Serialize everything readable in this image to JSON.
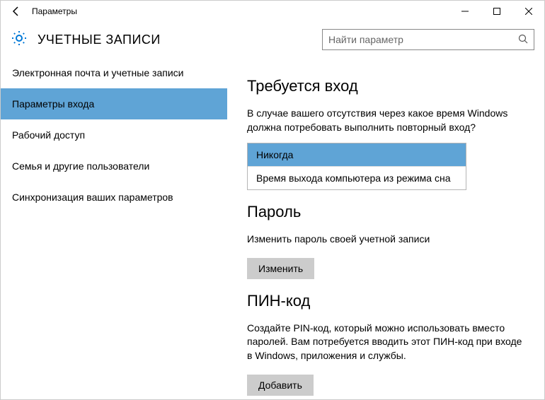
{
  "window": {
    "title": "Параметры"
  },
  "header": {
    "title": "УЧЕТНЫЕ ЗАПИСИ"
  },
  "search": {
    "placeholder": "Найти параметр"
  },
  "sidebar": {
    "items": [
      {
        "label": "Электронная почта и учетные записи"
      },
      {
        "label": "Параметры входа"
      },
      {
        "label": "Рабочий доступ"
      },
      {
        "label": "Семья и другие пользователи"
      },
      {
        "label": "Синхронизация ваших параметров"
      }
    ],
    "active_index": 1
  },
  "main": {
    "signin_required": {
      "title": "Требуется вход",
      "description": "В случае вашего отсутствия через какое время Windows должна потребовать выполнить повторный вход?",
      "options": [
        "Никогда",
        "Время выхода компьютера из режима сна"
      ],
      "selected_index": 0
    },
    "password": {
      "title": "Пароль",
      "description": "Изменить пароль своей учетной записи",
      "button": "Изменить"
    },
    "pin": {
      "title": "ПИН-код",
      "description": "Создайте PIN-код, который можно использовать вместо паролей. Вам потребуется вводить этот ПИН-код при входе в Windows, приложения и службы.",
      "button": "Добавить"
    }
  }
}
